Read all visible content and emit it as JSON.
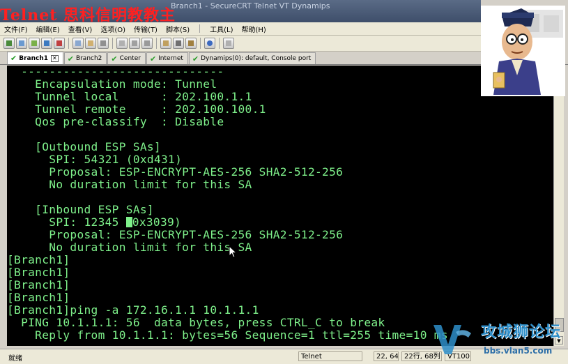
{
  "window": {
    "title": "Telnet 思科信明教教主",
    "title_rest": "Branch1 - SecureCRT   Telnet   VT   Dynamips"
  },
  "menu": [
    "文件(F)",
    "编辑(E)",
    "查看(V)",
    "选项(O)",
    "传输(T)",
    "脚本(S)",
    "工具(L)",
    "帮助(H)"
  ],
  "tabs": [
    {
      "label": "Branch1",
      "active": true
    },
    {
      "label": "Branch2",
      "active": false
    },
    {
      "label": "Center",
      "active": false
    },
    {
      "label": "Internet",
      "active": false
    },
    {
      "label": "Dynamips(0): default, Console port",
      "active": false
    }
  ],
  "terminal": {
    "lines": [
      "  -----------------------------",
      "    Encapsulation mode: Tunnel",
      "    Tunnel local      : 202.100.1.1",
      "    Tunnel remote     : 202.100.100.1",
      "    Qos pre-classify  : Disable",
      "",
      "    [Outbound ESP SAs]",
      "      SPI: 54321 (0xd431)",
      "      Proposal: ESP-ENCRYPT-AES-256 SHA2-512-256",
      "      No duration limit for this SA",
      "",
      "    [Inbound ESP SAs]",
      "      SPI: 12345 ",
      "      Proposal: ESP-ENCRYPT-AES-256 SHA2-512-256",
      "      No duration limit for this SA",
      "[Branch1]",
      "[Branch1]",
      "[Branch1]",
      "[Branch1]",
      "[Branch1]ping -a 172.16.1.1 10.1.1.1",
      "  PING 10.1.1.1: 56  data bytes, press CTRL_C to break",
      "    Reply from 10.1.1.1: bytes=56 Sequence=1 ttl=255 time=10 ms"
    ],
    "cursor_line_tail": "0x3039)"
  },
  "status": {
    "ready": "就绪",
    "protocol": "Telnet",
    "position": "22, 64",
    "rows_cols": "22行, 68列",
    "terminal_type": "VT100"
  },
  "watermark": {
    "text": "攻城狮论坛",
    "url": "bbs.vlan5.com"
  },
  "colors": {
    "terminal_bg": "#000000",
    "terminal_fg": "#7ef08a",
    "title_overlay": "#ff2020"
  }
}
